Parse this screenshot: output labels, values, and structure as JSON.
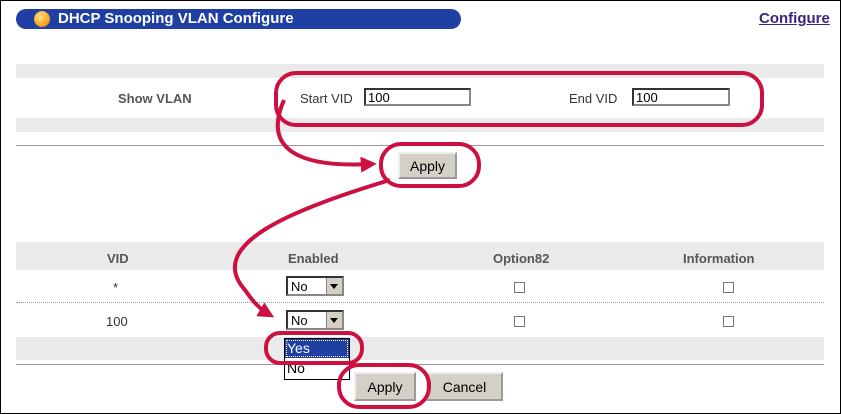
{
  "header": {
    "title": "DHCP Snooping VLAN Configure",
    "configure_link": "Configure"
  },
  "show_vlan": {
    "label": "Show VLAN",
    "start_vid_label": "Start VID",
    "start_vid_value": "100",
    "end_vid_label": "End VID",
    "end_vid_value": "100",
    "apply_label": "Apply"
  },
  "table": {
    "columns": [
      "VID",
      "Enabled",
      "Option82",
      "Information"
    ],
    "rows": [
      {
        "vid": "*",
        "enabled": "No"
      },
      {
        "vid": "100",
        "enabled": "No"
      }
    ]
  },
  "dropdown_options": [
    "Yes",
    "No"
  ],
  "footer": {
    "apply_label": "Apply",
    "cancel_label": "Cancel"
  },
  "colors": {
    "header_bg": "#1f3fa3",
    "callout": "#cc1040",
    "link": "#3b247a"
  },
  "icons": {
    "header_bullet": "orange-ball-icon",
    "select_arrow": "chevron-down-icon"
  }
}
